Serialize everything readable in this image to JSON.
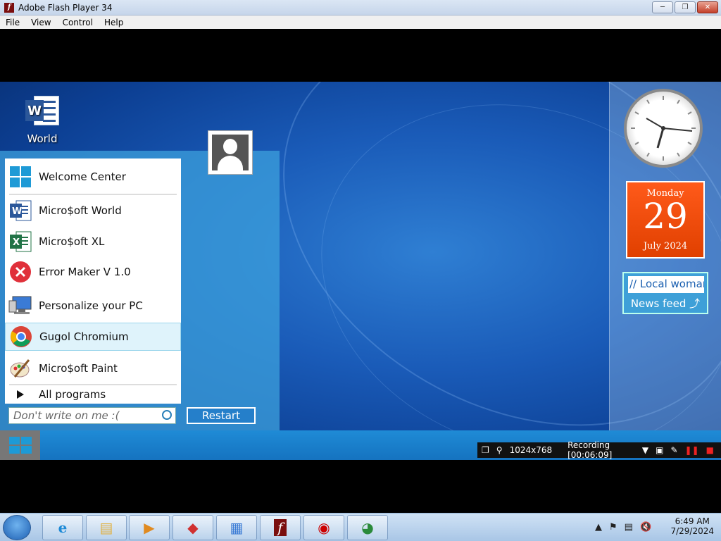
{
  "window": {
    "title": "Adobe Flash Player 34"
  },
  "menubar": {
    "items": [
      "File",
      "View",
      "Control",
      "Help"
    ]
  },
  "desktop": {
    "word_icon_label": "World",
    "start_menu": {
      "items": [
        {
          "label": "Welcome Center",
          "icon": "windows-logo-icon"
        },
        {
          "label": "Micro$oft World",
          "icon": "word-icon"
        },
        {
          "label": "Micro$oft XL",
          "icon": "excel-icon"
        },
        {
          "label": "Error Maker V 1.0",
          "icon": "error-icon"
        },
        {
          "label": "Personalize your PC",
          "icon": "monitor-icon"
        },
        {
          "label": "Gugol Chromium",
          "icon": "chrome-icon"
        },
        {
          "label": "Micro$oft Paint",
          "icon": "paint-icon"
        }
      ],
      "all_programs": "All programs",
      "search_placeholder": "Don't write on me :(",
      "restart": "Restart"
    },
    "gadgets": {
      "calendar": {
        "weekday": "Monday",
        "day": "29",
        "month_year": "July 2024"
      },
      "news": {
        "item": "// Local woman",
        "feed_label": "News feed"
      }
    },
    "recording_bar": {
      "resolution": "1024x768",
      "status": "Recording [00:06:09]"
    }
  },
  "taskbar": {
    "time": "6:49 AM",
    "date": "7/29/2024"
  },
  "colors": {
    "desktop_blue": "#1a5bb8",
    "start_panel": "#3ca0dc",
    "calendar_orange": "#ff5a1a"
  }
}
